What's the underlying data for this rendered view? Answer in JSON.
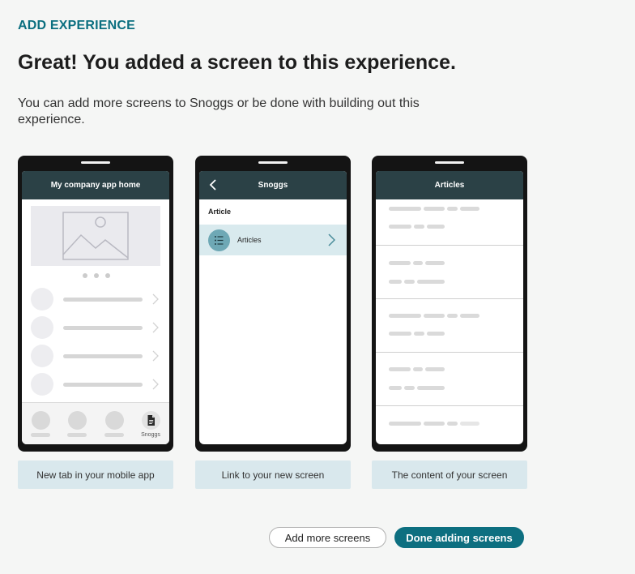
{
  "header": {
    "eyebrow": "ADD EXPERIENCE",
    "title": "Great! You added a screen to this experience.",
    "subtitle": "You can add more screens to Snoggs or be done with building out this experience."
  },
  "phones": [
    {
      "appbar_title": "My company app home",
      "tab_label": "Snoggs",
      "caption": "New tab in your mobile app"
    },
    {
      "appbar_title": "Snoggs",
      "section_heading": "Article",
      "row_label": "Articles",
      "caption": "Link to your new screen"
    },
    {
      "appbar_title": "Articles",
      "caption": "The content of your screen"
    }
  ],
  "actions": {
    "add_more_label": "Add more screens",
    "done_label": "Done adding screens"
  },
  "colors": {
    "accent": "#0d6f80",
    "appbar": "#2b4146",
    "caption_bg": "#d9e8ed",
    "selected_row": "#d9eaee"
  }
}
